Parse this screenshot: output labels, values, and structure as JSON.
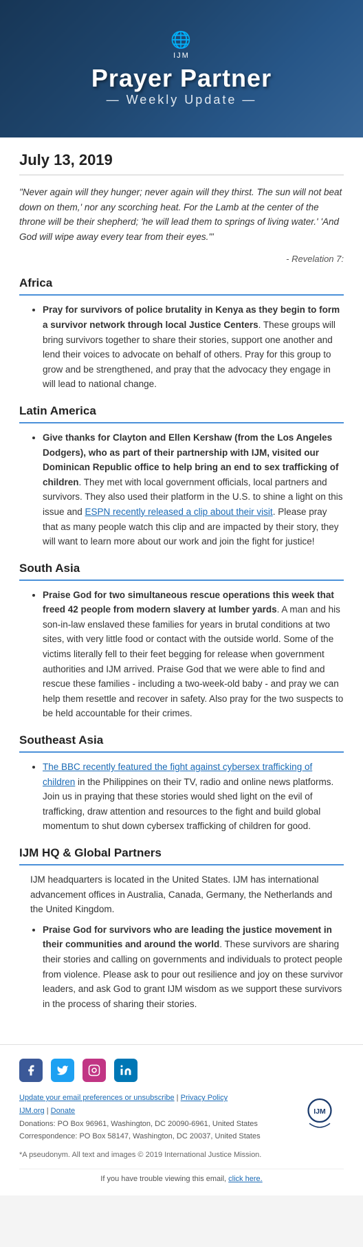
{
  "header": {
    "org_abbr": "IJM",
    "title_line1": "Prayer Partner",
    "title_line2": "— Weekly Update —"
  },
  "date": "July 13, 2019",
  "scripture": {
    "text": "\"Never again will they hunger; never again will they thirst. The sun will not beat down on them,' nor any scorching heat. For the Lamb at the center of the throne will be their shepherd; 'he will lead them to springs of living water.' 'And God will wipe away every tear from their eyes.'\"",
    "reference": "- Revelation 7:"
  },
  "sections": [
    {
      "id": "africa",
      "title": "Africa",
      "items": [
        "Pray for survivors of police brutality in Kenya as they begin to form a survivor network through local Justice Centers. These groups will bring survivors together to share their stories, support one another and lend their voices to advocate on behalf of others. Pray for this group to grow and be strengthened, and pray that the advocacy they engage in will lead to national change."
      ]
    },
    {
      "id": "latin-america",
      "title": "Latin America",
      "items": [
        "Give thanks for Clayton and Ellen Kershaw (from the Los Angeles Dodgers), who as part of their partnership with IJM, visited our Dominican Republic office to help bring an end to sex trafficking of children. They met with local government officials, local partners and survivors. They also used their platform in the U.S. to shine a light on this issue and ESPN recently released a clip about their visit. Please pray that as many people watch this clip and are impacted by their story, they will want to learn more about our work and join the fight for justice!",
        "espn_link"
      ]
    },
    {
      "id": "south-asia",
      "title": "South Asia",
      "items": [
        "Praise God for two simultaneous rescue operations this week that freed 42 people from modern slavery at lumber yards. A man and his son-in-law enslaved these families for years in brutal conditions at two sites, with very little food or contact with the outside world. Some of the victims literally fell to their feet begging for release when government authorities and IJM arrived. Praise God that we were able to find and rescue these families - including a two-week-old baby - and pray we can help them resettle and recover in safety. Also pray for the two suspects to be held accountable for their crimes."
      ]
    },
    {
      "id": "southeast-asia",
      "title": "Southeast Asia",
      "items": [
        "The BBC recently featured the fight against cybersex trafficking of children in the Philippines on their TV, radio and online news platforms. Join us in praying that these stories would shed light on the evil of trafficking, draw attention and resources to the fight and build global momentum to shut down cybersex trafficking of children for good."
      ]
    },
    {
      "id": "ijm-hq",
      "title": "IJM HQ & Global Partners",
      "intro": "IJM headquarters is located in the United States. IJM has international advancement offices in Australia, Canada, Germany, the Netherlands and the United Kingdom.",
      "items": [
        "Praise God for survivors who are leading the justice movement in their communities and around the world. These survivors are sharing their stories and calling on governments and individuals to protect people from violence. Please ask to pour out resilience and joy on these survivor leaders, and ask God to grant IJM wisdom as we support these survivors in the process of sharing their stories."
      ]
    }
  ],
  "footer": {
    "social": [
      {
        "name": "facebook",
        "label": "f"
      },
      {
        "name": "twitter",
        "label": "t"
      },
      {
        "name": "instagram",
        "label": "i"
      },
      {
        "name": "linkedin",
        "label": "in"
      }
    ],
    "update_prefs": "Update your email preferences or unsubscribe",
    "privacy_label": "Privacy Policy",
    "ijm_org": "IJM.org",
    "donate": "Donate",
    "donations_address": "Donations: PO Box 96961, Washington, DC 20090-6961, United States",
    "correspondence_address": "Correspondence: PO Box 58147, Washington, DC 20037, United States",
    "pseudonym_note": "*A pseudonym. All text and images © 2019 International Justice Mission.",
    "view_email_text": "If you have trouble viewing this email,",
    "click_here": "click here."
  }
}
